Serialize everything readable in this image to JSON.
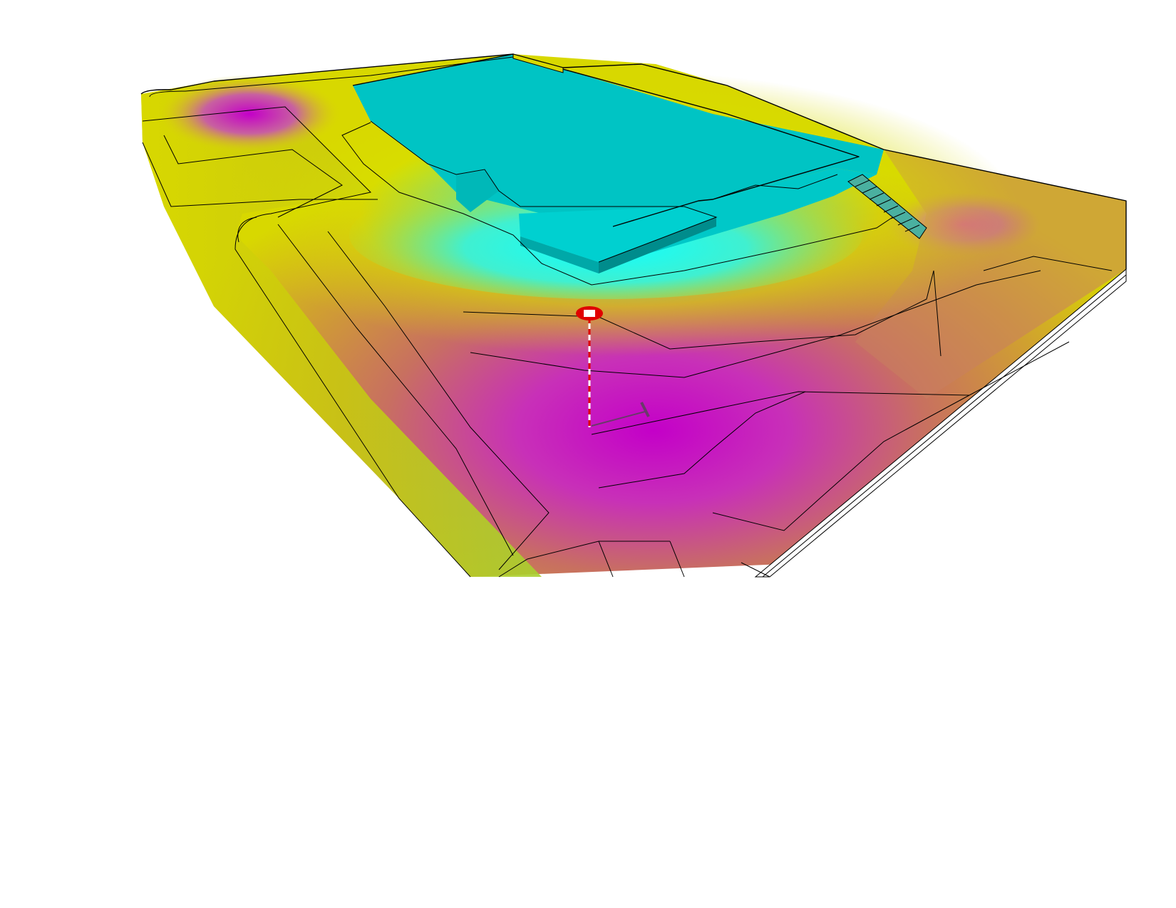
{
  "view": {
    "mode": "3d-site-model",
    "style": "elevation-color-map"
  },
  "colors": {
    "low": "#c400c8",
    "mid_low": "#c87060",
    "mid": "#d8d800",
    "mid_high": "#a8d030",
    "high": "#00ffff",
    "pad": "#00c4c4",
    "pad_side": "#008c8c",
    "background": "#ffffff",
    "marker": "#e00000"
  },
  "icons": {
    "survey_marker": "elevation-marker-icon",
    "stairs": "stairs-icon"
  }
}
